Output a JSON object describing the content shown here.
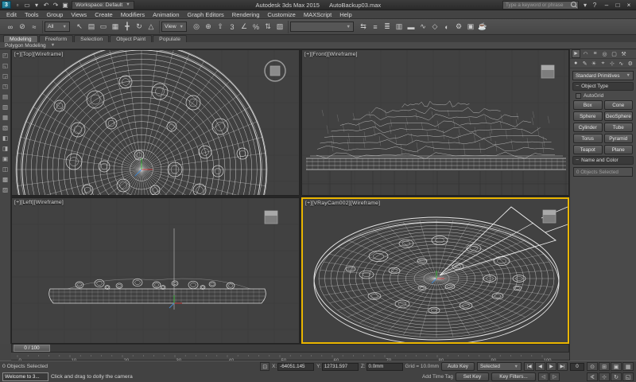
{
  "colors": {
    "wireframe": "#e4e4e4",
    "viewport_bg": "#414141",
    "active_viewport_border": "#e9b500",
    "axis_x": "#cc4444",
    "axis_y": "#44bb44",
    "axis_z": "#4488cc"
  },
  "titlebar": {
    "workspace": "Workspace: Default",
    "app_title": "Autodesk 3ds Max 2015",
    "doc_title": "AutoBackup03.max",
    "search_placeholder": "Type a keyword or phrase",
    "quick_access": [
      {
        "n": "new-scene-icon",
        "g": "▫"
      },
      {
        "n": "open-file-icon",
        "g": "▭"
      },
      {
        "n": "save-file-icon",
        "g": "▾"
      },
      {
        "n": "undo-icon",
        "g": "↶"
      },
      {
        "n": "redo-icon",
        "g": "↷"
      },
      {
        "n": "project-folder-icon",
        "g": "▣"
      }
    ],
    "info_icons": [
      {
        "n": "sign-in-icon",
        "g": "▾"
      },
      {
        "n": "help-icon",
        "g": "?"
      }
    ],
    "window_controls": [
      {
        "n": "minimize-button",
        "g": "–"
      },
      {
        "n": "maximize-button",
        "g": "□"
      },
      {
        "n": "close-button",
        "g": "×"
      }
    ]
  },
  "menubar": [
    "Edit",
    "Tools",
    "Group",
    "Views",
    "Create",
    "Modifiers",
    "Animation",
    "Graph Editors",
    "Rendering",
    "Customize",
    "MAXScript",
    "Help"
  ],
  "toolbar": {
    "group1": [
      {
        "n": "select-and-link-icon",
        "g": "∞"
      },
      {
        "n": "unlink-selection-icon",
        "g": "⊘"
      },
      {
        "n": "bind-to-space-warp-icon",
        "g": "≈"
      }
    ],
    "filter_dropdown": "All",
    "group2": [
      {
        "n": "select-object-icon",
        "g": "↖"
      },
      {
        "n": "select-by-name-icon",
        "g": "▤"
      },
      {
        "n": "rectangular-selection-region-icon",
        "g": "▭"
      },
      {
        "n": "window-crossing-icon",
        "g": "▦"
      },
      {
        "n": "select-and-move-icon",
        "g": "╋"
      },
      {
        "n": "select-and-rotate-icon",
        "g": "↻"
      },
      {
        "n": "select-and-scale-icon",
        "g": "△"
      }
    ],
    "coord_dropdown": "View",
    "group3": [
      {
        "n": "use-pivot-point-center-icon",
        "g": "◎"
      },
      {
        "n": "select-and-manipulate-icon",
        "g": "⊕"
      },
      {
        "n": "keyboard-shortcut-override-icon",
        "g": "⇧"
      },
      {
        "n": "snaps-toggle-icon",
        "g": "3"
      },
      {
        "n": "angle-snap-icon",
        "g": "∠"
      },
      {
        "n": "percent-snap-icon",
        "g": "%"
      },
      {
        "n": "spinner-snap-icon",
        "g": "⇅"
      },
      {
        "n": "edit-named-selection-sets-icon",
        "g": "▧"
      }
    ],
    "selection_set_dropdown": "",
    "group4": [
      {
        "n": "mirror-icon",
        "g": "⇆"
      },
      {
        "n": "align-icon",
        "g": "≡"
      },
      {
        "n": "toggle-scene-explorer-icon",
        "g": "≣"
      },
      {
        "n": "toggle-layer-explorer-icon",
        "g": "▥"
      },
      {
        "n": "toggle-ribbon-icon",
        "g": "▬"
      },
      {
        "n": "curve-editor-icon",
        "g": "∿"
      },
      {
        "n": "schematic-view-icon",
        "g": "◇"
      },
      {
        "n": "material-editor-icon",
        "g": "◐"
      },
      {
        "n": "render-setup-icon",
        "g": "⚙"
      },
      {
        "n": "rendered-frame-window-icon",
        "g": "▣"
      },
      {
        "n": "render-production-icon",
        "g": "☕"
      }
    ]
  },
  "ribbon": {
    "tabs": [
      "Modeling",
      "Freeform",
      "Selection",
      "Object Paint",
      "Populate"
    ],
    "panel_label": "Polygon Modeling"
  },
  "left_dock": [
    {
      "n": "left-toolbar-icon",
      "g": "◰"
    },
    {
      "n": "left-toolbar-icon",
      "g": "◱"
    },
    {
      "n": "left-toolbar-icon",
      "g": "◲"
    },
    {
      "n": "left-toolbar-icon",
      "g": "◳"
    },
    {
      "n": "left-toolbar-icon",
      "g": "▤"
    },
    {
      "n": "left-toolbar-icon",
      "g": "▥"
    },
    {
      "n": "left-toolbar-icon",
      "g": "▦"
    },
    {
      "n": "left-toolbar-icon",
      "g": "▧"
    },
    {
      "n": "left-toolbar-icon",
      "g": "◧"
    },
    {
      "n": "left-toolbar-icon",
      "g": "◨"
    },
    {
      "n": "left-toolbar-icon",
      "g": "▣"
    },
    {
      "n": "left-toolbar-icon",
      "g": "◫"
    },
    {
      "n": "left-toolbar-icon",
      "g": "▩"
    },
    {
      "n": "left-toolbar-icon",
      "g": "▨"
    }
  ],
  "viewports": {
    "top": {
      "label": "[+][Top][Wireframe]"
    },
    "front": {
      "label": "[+][Front][Wireframe]"
    },
    "left": {
      "label": "[+][Left][Wireframe]"
    },
    "camera": {
      "label": "[+][VRayCam002][Wireframe]"
    }
  },
  "command_panel": {
    "tabs": [
      {
        "n": "create-tab-icon",
        "g": "►"
      },
      {
        "n": "modify-tab-icon",
        "g": "◠"
      },
      {
        "n": "hierarchy-tab-icon",
        "g": "≡"
      },
      {
        "n": "motion-tab-icon",
        "g": "◎"
      },
      {
        "n": "display-tab-icon",
        "g": "▢"
      },
      {
        "n": "utilities-tab-icon",
        "g": "⚒"
      }
    ],
    "categories": [
      {
        "n": "geometry-category-icon",
        "g": "●"
      },
      {
        "n": "shapes-category-icon",
        "g": "✎"
      },
      {
        "n": "lights-category-icon",
        "g": "☀"
      },
      {
        "n": "cameras-category-icon",
        "g": "⌖"
      },
      {
        "n": "helpers-category-icon",
        "g": "⊹"
      },
      {
        "n": "space-warps-category-icon",
        "g": "∿"
      },
      {
        "n": "systems-category-icon",
        "g": "⚙"
      }
    ],
    "subcategory_dropdown": "Standard Primitives",
    "object_type_title": "Object Type",
    "autogrid_label": "AutoGrid",
    "object_buttons": [
      "Box",
      "Cone",
      "Sphere",
      "GeoSphere",
      "Cylinder",
      "Tube",
      "Torus",
      "Pyramid",
      "Teapot",
      "Plane"
    ],
    "name_color_title": "Name and Color",
    "name_field": "0 Objects Selected"
  },
  "timeline": {
    "slider_label": "0 / 100",
    "tick_labels": [
      "0",
      "10",
      "20",
      "30",
      "40",
      "50",
      "60",
      "70",
      "80",
      "90",
      "100"
    ]
  },
  "statusbar": {
    "selection_status": "0 Objects Selected",
    "minimized_window": "Welcome to 3...",
    "prompt": "Click and drag to dolly the camera",
    "coord_x_label": "X:",
    "coord_y_label": "Y:",
    "coord_z_label": "Z:",
    "coord_x": "-64051.145",
    "coord_y": "12731.597",
    "coord_z": "0.0mm",
    "grid_label": "Grid = 10.0mm",
    "add_time_tag": "Add Time Tag",
    "auto_key": "Auto Key",
    "set_key": "Set Key",
    "selected_dropdown": "Selected",
    "key_filters": "Key Filters...",
    "current_frame": "0",
    "playback1": [
      {
        "n": "go-to-start-button",
        "g": "|◀"
      },
      {
        "n": "previous-frame-button",
        "g": "◀"
      },
      {
        "n": "play-button",
        "g": "▶"
      },
      {
        "n": "go-to-end-button",
        "g": "▶|"
      }
    ],
    "playback2": [
      {
        "n": "previous-key-button",
        "g": "◁"
      },
      {
        "n": "next-key-button",
        "g": "▷"
      }
    ],
    "nav1": [
      {
        "n": "zoom-icon",
        "g": "⊙"
      },
      {
        "n": "zoom-all-icon",
        "g": "⊞"
      },
      {
        "n": "zoom-extents-icon",
        "g": "▣"
      },
      {
        "n": "zoom-extents-all-icon",
        "g": "▦"
      }
    ],
    "nav2": [
      {
        "n": "field-of-view-icon",
        "g": "∢"
      },
      {
        "n": "pan-view-icon",
        "g": "⊹"
      },
      {
        "n": "orbit-camera-icon",
        "g": "↻"
      },
      {
        "n": "maximize-viewport-toggle-icon",
        "g": "◱"
      }
    ]
  }
}
